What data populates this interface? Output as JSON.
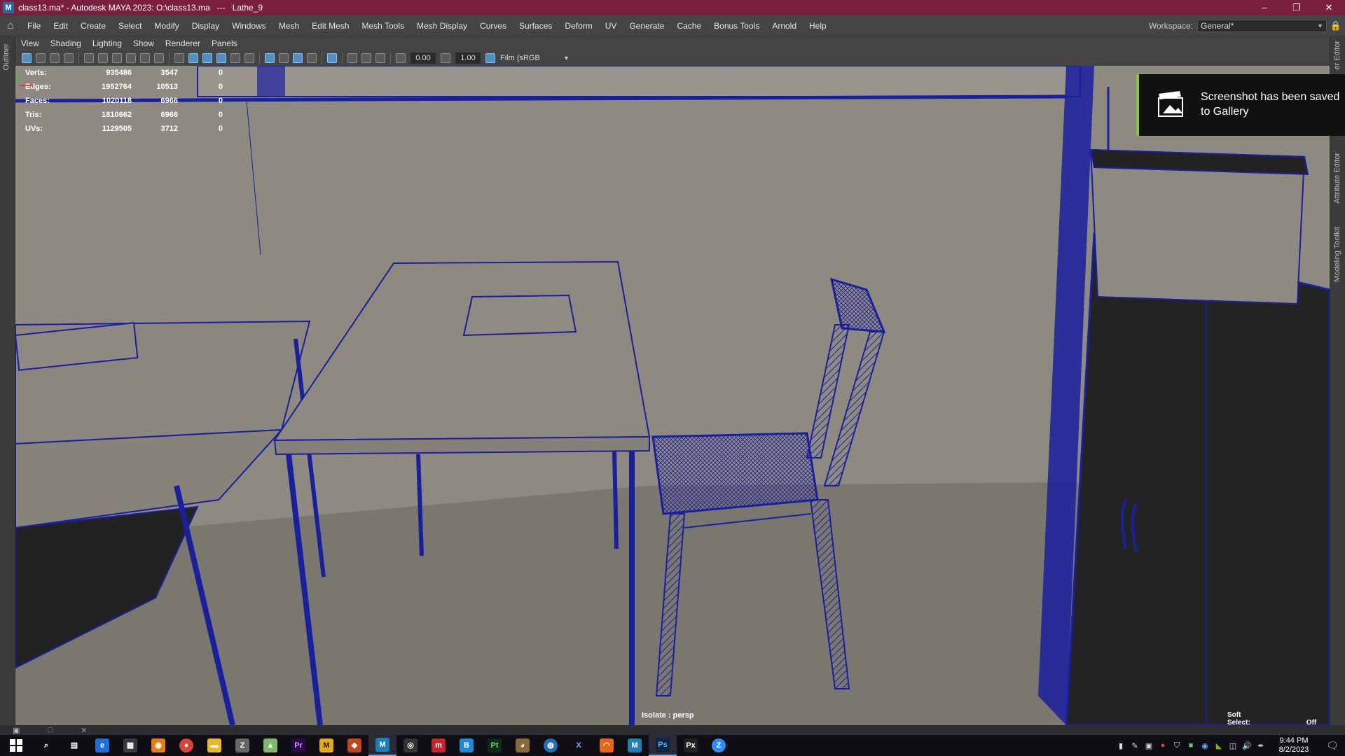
{
  "window": {
    "title": "class13.ma* - Autodesk MAYA 2023: O:\\class13.ma",
    "separator": "---",
    "object": "Lathe_9",
    "buttons": [
      "–",
      "❐",
      "✕"
    ]
  },
  "menubar": {
    "items": [
      "File",
      "Edit",
      "Create",
      "Select",
      "Modify",
      "Display",
      "Windows",
      "Mesh",
      "Edit Mesh",
      "Mesh Tools",
      "Mesh Display",
      "Curves",
      "Surfaces",
      "Deform",
      "UV",
      "Generate",
      "Cache",
      "Bonus Tools",
      "Arnold",
      "Help"
    ],
    "workspace_label": "Workspace:",
    "workspace_value": "General*"
  },
  "side_tabs": {
    "left": "Outliner",
    "right": [
      "er Editor",
      "Attribute Editor",
      "Modeling Toolkit"
    ]
  },
  "panel_menu": [
    "View",
    "Shading",
    "Lighting",
    "Show",
    "Renderer",
    "Panels"
  ],
  "panel_toolbar": {
    "exposure": "0.00",
    "gamma": "1.00",
    "color_space": "Film (sRGB"
  },
  "hud": {
    "rows": [
      {
        "label": "Verts:",
        "v1": "935486",
        "v2": "3547",
        "v3": "0"
      },
      {
        "label": "Edges:",
        "v1": "1952764",
        "v2": "10513",
        "v3": "0"
      },
      {
        "label": "Faces:",
        "v1": "1020118",
        "v2": "6966",
        "v3": "0"
      },
      {
        "label": "Tris:",
        "v1": "1810662",
        "v2": "6966",
        "v3": "0"
      },
      {
        "label": "UVs:",
        "v1": "1129505",
        "v2": "3712",
        "v3": "0"
      }
    ],
    "isolate": "Isolate : persp",
    "soft_select_label": "Soft Select:",
    "soft_select_value": "Off"
  },
  "toast": {
    "message": "Screenshot has been saved to Gallery"
  },
  "colors": {
    "titlebar": "#7a1f3d",
    "wire": "#1a1f9e",
    "toast_accent": "#8cc63f",
    "viewport_bg": "#8f8a80"
  },
  "taskbar": {
    "apps": [
      "search-icon",
      "task-view-icon",
      "edge-icon",
      "store-icon",
      "blender-icon",
      "chrome-icon",
      "explorer-icon",
      "zbrush-icon",
      "app-icon",
      "premiere-icon",
      "marmoset-icon",
      "substance-icon",
      "maya-icon",
      "vpn-icon",
      "mudbox-icon",
      "b-icon",
      "pt-icon",
      "gimp-icon",
      "steam-icon",
      "x-icon",
      "houdini-icon",
      "maya2-icon",
      "photoshop-icon",
      "px-icon",
      "zoom-icon"
    ],
    "time": "9:44 PM",
    "date": "8/2/2023"
  }
}
